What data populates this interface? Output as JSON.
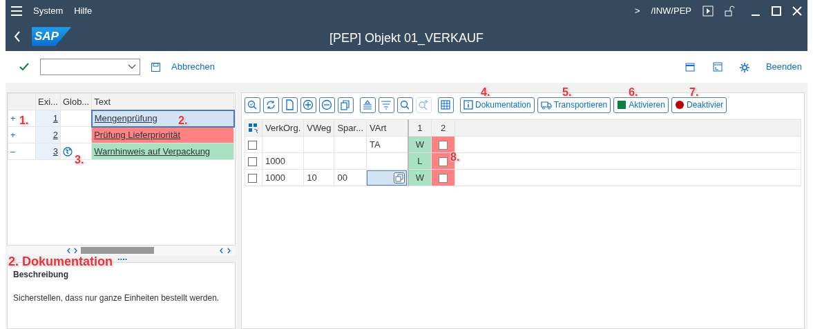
{
  "menu_bar": {
    "menus": [
      "System",
      "Hilfe"
    ],
    "nav_sign": ">",
    "transaction": "/INW/PEP"
  },
  "title_bar": {
    "logo": "SAP",
    "title": "[PEP] Objekt 01_VERKAUF"
  },
  "toolbar": {
    "cancel": "Abbrechen",
    "exit": "Beenden"
  },
  "check_table": {
    "columns": [
      "Exi...",
      "Glob...",
      "Text"
    ],
    "rows": [
      {
        "sign": "+",
        "number": "1",
        "global": false,
        "text": "Mengenprüfung",
        "selected": true,
        "color": "#d1e3f5"
      },
      {
        "sign": "+",
        "number": "2",
        "global": false,
        "text": "Prüfung Lieferpriorität",
        "selected": false,
        "color": "#ff8282"
      },
      {
        "sign": "–",
        "number": "3",
        "global": true,
        "text": "Warnhinweis auf Verpackung",
        "selected": false,
        "color": "#a9e2c3"
      }
    ]
  },
  "doc_link": "....",
  "documentation": {
    "heading": "Beschreibung",
    "text": "Sicherstellen, dass nur ganze Einheiten bestellt werden."
  },
  "grid_toolbar": {
    "icon_buttons": [
      {
        "kind": "details",
        "disabled": false
      },
      {
        "kind": "refresh",
        "disabled": false
      },
      {
        "kind": "page",
        "disabled": false
      },
      {
        "kind": "plus",
        "disabled": false
      },
      {
        "kind": "minus",
        "disabled": false
      },
      {
        "kind": "copy",
        "disabled": false
      },
      {
        "kind": "sortup",
        "disabled": false
      },
      {
        "kind": "filter",
        "disabled": false
      },
      {
        "kind": "search",
        "disabled": false
      },
      {
        "kind": "searchnext",
        "disabled": true
      },
      {
        "kind": "grid",
        "disabled": false
      }
    ],
    "text_buttons": [
      {
        "kind": "info",
        "label": "Dokumentation"
      },
      {
        "kind": "truck",
        "label": "Transportieren"
      },
      {
        "kind": "square",
        "label": "Aktivieren"
      },
      {
        "kind": "dot",
        "label": "Deaktivier"
      }
    ]
  },
  "grid": {
    "columns": [
      "VerkOrg.",
      "VWeg",
      "Spar...",
      "VArt",
      "1",
      "2"
    ],
    "rows": [
      {
        "checked": false,
        "verkorg": "",
        "vweg": "",
        "spar": "",
        "vart": "TA",
        "editing": false,
        "status": "W",
        "flag": false
      },
      {
        "checked": false,
        "verkorg": "1000",
        "vweg": "",
        "spar": "",
        "vart": "",
        "editing": false,
        "status": "L",
        "flag": false
      },
      {
        "checked": false,
        "verkorg": "1000",
        "vweg": "10",
        "spar": "00",
        "vart": "",
        "editing": true,
        "status": "W",
        "flag": false
      }
    ]
  },
  "callouts": [
    "1.",
    "2.",
    "3.",
    "4.",
    "5.",
    "6.",
    "7.",
    "8.",
    "2. Dokumentation"
  ]
}
